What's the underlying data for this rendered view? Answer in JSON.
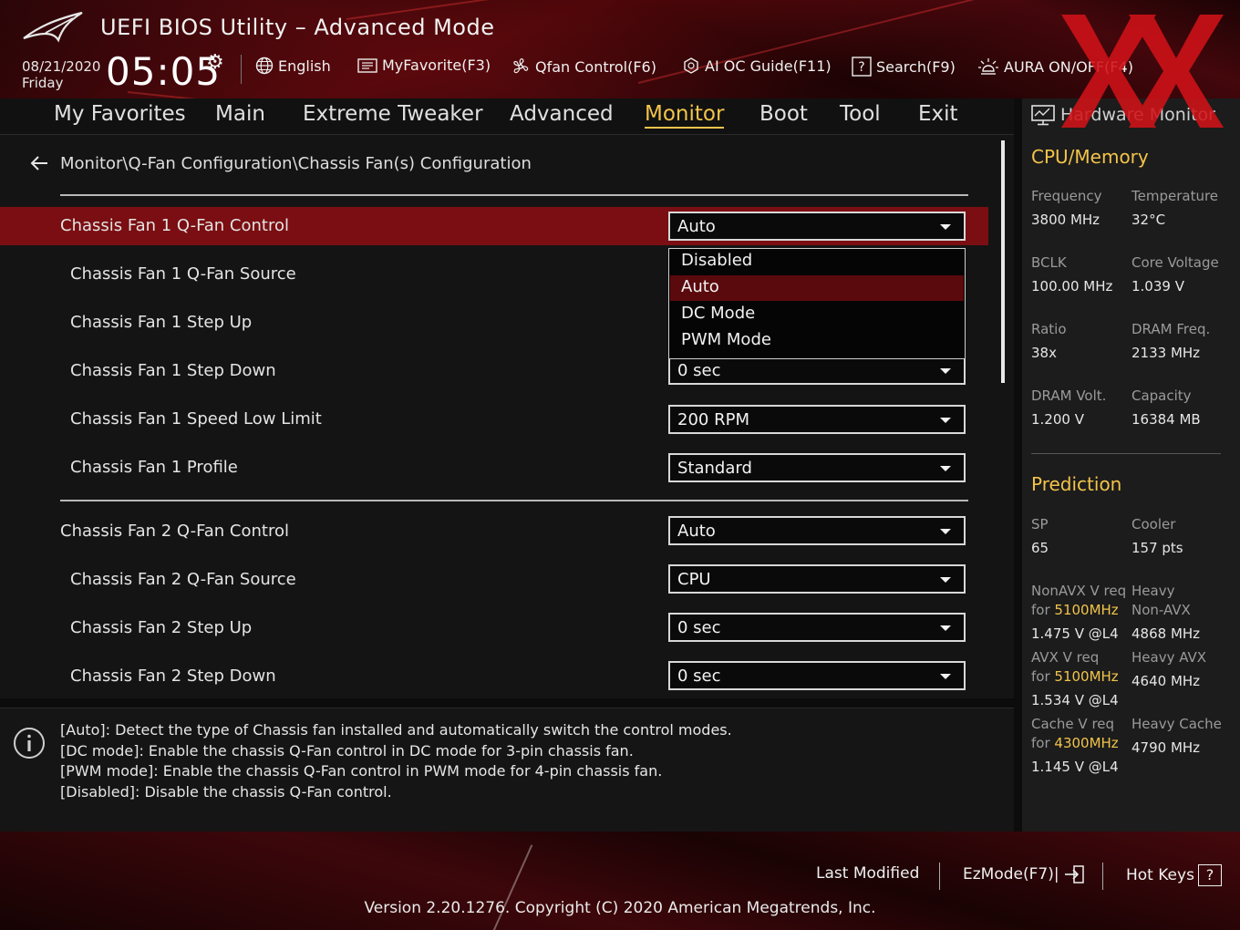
{
  "header": {
    "title": "UEFI BIOS Utility – Advanced Mode",
    "date": "08/21/2020",
    "day": "Friday",
    "time": "05:05",
    "items": {
      "language": "English",
      "favorite": "MyFavorite(F3)",
      "qfan": "Qfan Control(F6)",
      "aioc": "AI OC Guide(F11)",
      "search": "Search(F9)",
      "aura": "AURA ON/OFF(F4)"
    }
  },
  "nav": {
    "tabs": [
      "My Favorites",
      "Main",
      "Extreme Tweaker",
      "Advanced",
      "Monitor",
      "Boot",
      "Tool",
      "Exit"
    ],
    "active": "Monitor"
  },
  "main": {
    "breadcrumb": "Monitor\\Q-Fan Configuration\\Chassis Fan(s) Configuration",
    "rows": [
      {
        "label": "Chassis Fan 1 Q-Fan Control",
        "value": "Auto"
      },
      {
        "label": "Chassis Fan 1 Q-Fan Source",
        "value": ""
      },
      {
        "label": "Chassis Fan 1 Step Up",
        "value": ""
      },
      {
        "label": "Chassis Fan 1 Step Down",
        "value": "0 sec"
      },
      {
        "label": "Chassis Fan 1 Speed Low Limit",
        "value": "200 RPM"
      },
      {
        "label": "Chassis Fan 1 Profile",
        "value": "Standard"
      },
      {
        "label": "Chassis Fan 2 Q-Fan Control",
        "value": "Auto"
      },
      {
        "label": "Chassis Fan 2 Q-Fan Source",
        "value": "CPU"
      },
      {
        "label": "Chassis Fan 2 Step Up",
        "value": "0 sec"
      },
      {
        "label": "Chassis Fan 2 Step Down",
        "value": "0 sec"
      }
    ],
    "dropdown": {
      "options": [
        "Disabled",
        "Auto",
        "DC Mode",
        "PWM Mode"
      ],
      "selected": "Auto"
    }
  },
  "help": {
    "lines": [
      "[Auto]: Detect the type of Chassis fan installed and automatically switch the control modes.",
      "[DC mode]: Enable the chassis Q-Fan control in DC mode for 3-pin chassis fan.",
      "[PWM mode]: Enable the chassis Q-Fan control in PWM mode for 4-pin chassis fan.",
      "[Disabled]: Disable the chassis Q-Fan control."
    ]
  },
  "hw_monitor": {
    "title": "Hardware Monitor",
    "cpu_memory": {
      "heading": "CPU/Memory",
      "frequency_label": "Frequency",
      "frequency": "3800 MHz",
      "temperature_label": "Temperature",
      "temperature": "32°C",
      "bclk_label": "BCLK",
      "bclk": "100.00 MHz",
      "core_voltage_label": "Core Voltage",
      "core_voltage": "1.039 V",
      "ratio_label": "Ratio",
      "ratio": "38x",
      "dram_freq_label": "DRAM Freq.",
      "dram_freq": "2133 MHz",
      "dram_volt_label": "DRAM Volt.",
      "dram_volt": "1.200 V",
      "capacity_label": "Capacity",
      "capacity": "16384 MB"
    },
    "prediction": {
      "heading": "Prediction",
      "sp_label": "SP",
      "sp": "65",
      "cooler_label": "Cooler",
      "cooler": "157 pts",
      "nonavx_req": "NonAVX V req",
      "for": "for",
      "nonavx_freq": "5100MHz",
      "nonavx_v": "1.475 V @L4",
      "heavy_label": "Heavy",
      "nonavx_label": "Non-AVX",
      "heavy_nonavx": "4868 MHz",
      "avx_req": "AVX V req",
      "avx_freq": "5100MHz",
      "avx_v": "1.534 V @L4",
      "heavy_avx_label": "Heavy AVX",
      "heavy_avx": "4640 MHz",
      "cache_req": "Cache V req",
      "cache_freq": "4300MHz",
      "cache_v": "1.145 V @L4",
      "heavy_cache_label": "Heavy Cache",
      "heavy_cache": "4790 MHz"
    }
  },
  "footer": {
    "last_modified": "Last Modified",
    "ezmode": "EzMode(F7)|",
    "hotkeys": "Hot Keys",
    "hotkeys_key": "?",
    "version": "Version 2.20.1276. Copyright (C) 2020 American Megatrends, Inc."
  },
  "colors": {
    "accent": "#f3c44a",
    "highlight_row": "#7a0e12",
    "selected_option": "#5a0a0d"
  }
}
